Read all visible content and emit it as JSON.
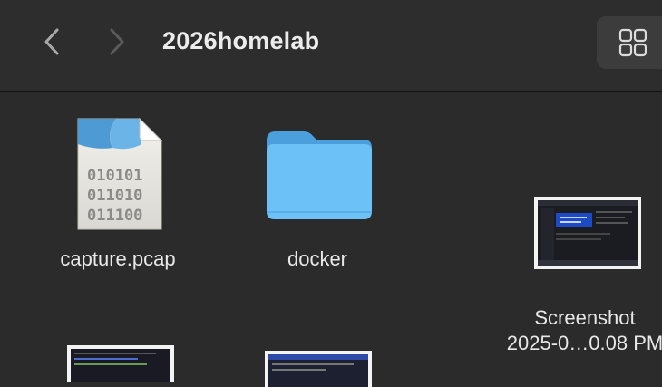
{
  "toolbar": {
    "title": "2026homelab",
    "back_icon": "chevron-left-icon",
    "forward_icon": "chevron-right-icon",
    "view_icon": "grid-view-icon"
  },
  "files": [
    {
      "name": "capture.pcap",
      "icon": "binary-document-icon",
      "doc_lines": [
        "010101",
        "011010",
        "011100"
      ]
    },
    {
      "name": "docker",
      "icon": "folder-icon"
    },
    {
      "name_line1": "Screenshot",
      "name_line2": "2025-0…0.08 PM",
      "icon": "screenshot-thumbnail"
    },
    {
      "icon": "screenshot-thumbnail"
    },
    {
      "icon": "screenshot-thumbnail"
    }
  ],
  "colors": {
    "folder": "#6cc1f6",
    "folder_tab": "#4a9fdc",
    "background": "#2b2b2b"
  }
}
